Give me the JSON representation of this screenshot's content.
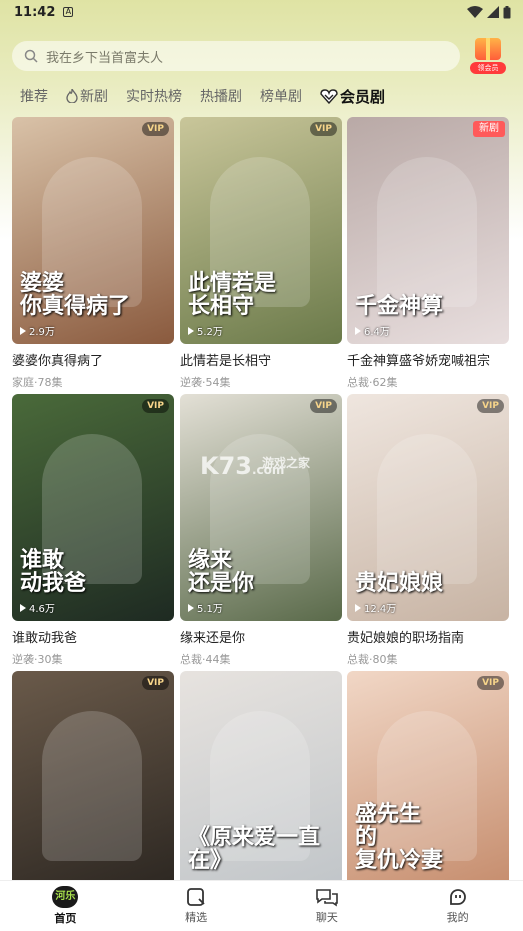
{
  "status": {
    "time": "11:42",
    "notif": "A"
  },
  "search": {
    "placeholder": "我在乡下当首富夫人",
    "gift_label": "领会员"
  },
  "tabs": [
    {
      "label": "推荐",
      "active": false,
      "icon": ""
    },
    {
      "label": "新剧",
      "active": false,
      "icon": "flame-icon"
    },
    {
      "label": "实时热榜",
      "active": false,
      "icon": ""
    },
    {
      "label": "热播剧",
      "active": false,
      "icon": ""
    },
    {
      "label": "榜单剧",
      "active": false,
      "icon": ""
    },
    {
      "label": "会员剧",
      "active": true,
      "icon": "heart-vip-icon"
    }
  ],
  "cards": [
    {
      "title": "婆婆你真得病了",
      "meta": "家庭·78集",
      "plays": "2.9万",
      "badge": "VIP",
      "poster_text": "婆婆\n你真得病了",
      "colors": [
        "#8a5a3e",
        "#d9c2a8"
      ]
    },
    {
      "title": "此情若是长相守",
      "meta": "逆袭·54集",
      "plays": "5.2万",
      "badge": "VIP",
      "poster_text": "此情若是\n长相守",
      "colors": [
        "#6b7a4a",
        "#c9c69a"
      ]
    },
    {
      "title": "千金神算盛爷娇宠喊祖宗",
      "meta": "总裁·62集",
      "plays": "6.4万",
      "badge": "新剧",
      "poster_text": "千金神算",
      "colors": [
        "#e8dede",
        "#b9a9a6"
      ]
    },
    {
      "title": "谁敢动我爸",
      "meta": "逆袭·30集",
      "plays": "4.6万",
      "badge": "VIP",
      "poster_text": "谁敢\n动我爸",
      "colors": [
        "#1e2a22",
        "#4a6a3a"
      ]
    },
    {
      "title": "缘来还是你",
      "meta": "总裁·44集",
      "plays": "5.1万",
      "badge": "VIP",
      "poster_text": "缘来\n还是你",
      "colors": [
        "#5a6a4a",
        "#e3e0d6"
      ]
    },
    {
      "title": "贵妃娘娘的职场指南",
      "meta": "总裁·80集",
      "plays": "12.4万",
      "badge": "VIP",
      "poster_text": "贵妃娘娘",
      "colors": [
        "#c7b3a3",
        "#efe6df"
      ]
    },
    {
      "title": "",
      "meta": "",
      "plays": "",
      "badge": "VIP",
      "poster_text": "",
      "colors": [
        "#2a2520",
        "#6a5a4a"
      ]
    },
    {
      "title": "",
      "meta": "",
      "plays": "",
      "badge": "",
      "poster_text": "《原来爱一直在》",
      "colors": [
        "#bfc4c8",
        "#e7e3df"
      ]
    },
    {
      "title": "",
      "meta": "",
      "plays": "",
      "badge": "VIP",
      "poster_text": "盛先生\n的\n复仇冷妻",
      "colors": [
        "#c48a6a",
        "#f1d7c6"
      ]
    }
  ],
  "watermark": {
    "main": "K73",
    "sub": "游戏之家",
    "tld": ".com"
  },
  "nav": [
    {
      "label": "首页",
      "icon": "home-logo-icon",
      "active": true,
      "logo_text": "河乐"
    },
    {
      "label": "精选",
      "icon": "play-square-icon",
      "active": false
    },
    {
      "label": "聊天",
      "icon": "chat-icon",
      "active": false
    },
    {
      "label": "我的",
      "icon": "profile-icon",
      "active": false
    }
  ]
}
